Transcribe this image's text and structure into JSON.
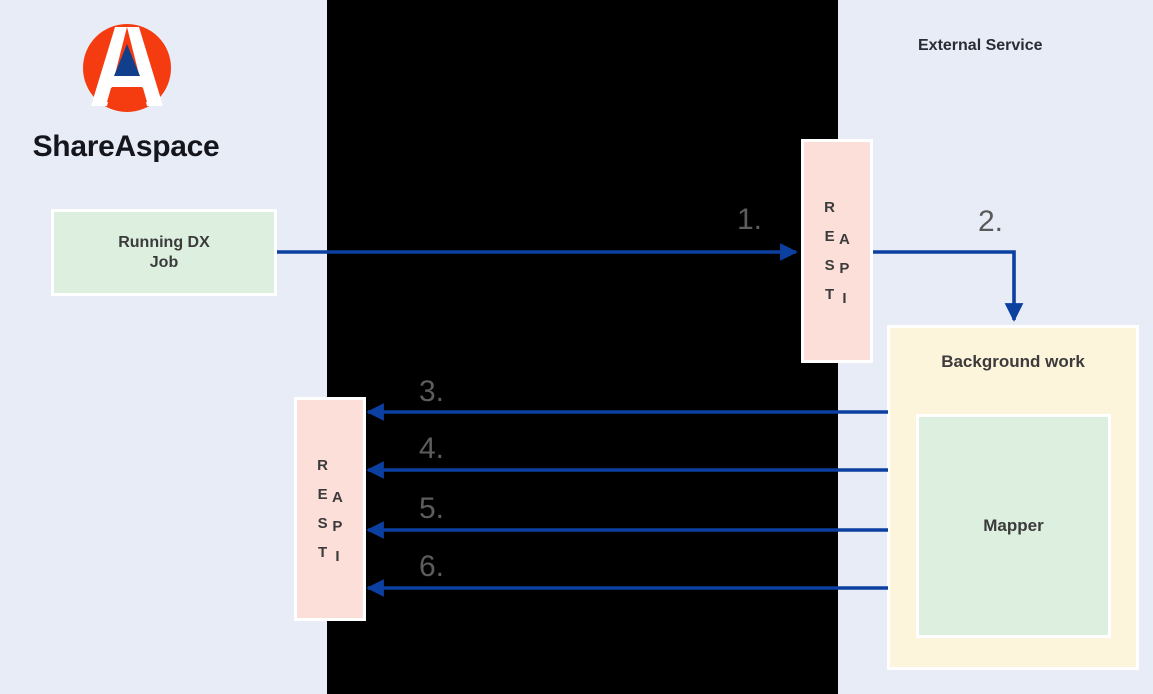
{
  "diagram": {
    "title": "ShareAspace DX Job to External Service integration flow",
    "background_color": "#e8ecf6",
    "band_color": "#000000",
    "accent_arrow_color": "#0b3fa0",
    "step_label_color": "#595959"
  },
  "brand": {
    "name": "ShareAspace",
    "logo_icon": "shareaspace-logo-icon",
    "logo_circle_color": "#f53c10",
    "logo_triangle_color": "#123f8c"
  },
  "labels": {
    "external_service": "External Service"
  },
  "nodes": {
    "dx_job": {
      "label": "Running DX\nJob",
      "label_line1": "Running DX",
      "label_line2": "Job",
      "fill": "#ddf0e0"
    },
    "rest_api_external": {
      "label": "REST API",
      "letters_left": [
        "R",
        "E",
        "S",
        "T"
      ],
      "letters_right": [
        "A",
        "P",
        "I"
      ],
      "fill": "#fcdfd8"
    },
    "rest_api_shareaspace": {
      "label": "REST API",
      "letters_left": [
        "R",
        "E",
        "S",
        "T"
      ],
      "letters_right": [
        "A",
        "P",
        "I"
      ],
      "fill": "#fcdfd8"
    },
    "background_work": {
      "label": "Background work",
      "fill": "#fdf4dc"
    },
    "mapper": {
      "label": "Mapper",
      "fill": "#ddf0e0"
    }
  },
  "steps": [
    {
      "id": "1",
      "label": "1.",
      "from": "dx_job",
      "to": "rest_api_external",
      "direction": "right"
    },
    {
      "id": "2",
      "label": "2.",
      "from": "rest_api_external",
      "to": "background_work",
      "direction": "right-then-down"
    },
    {
      "id": "3",
      "label": "3.",
      "from": "background_work",
      "to": "rest_api_shareaspace",
      "direction": "left"
    },
    {
      "id": "4",
      "label": "4.",
      "from": "background_work",
      "to": "rest_api_shareaspace",
      "direction": "left"
    },
    {
      "id": "5",
      "label": "5.",
      "from": "background_work",
      "to": "rest_api_shareaspace",
      "direction": "left"
    },
    {
      "id": "6",
      "label": "6.",
      "from": "background_work",
      "to": "rest_api_shareaspace",
      "direction": "left"
    }
  ]
}
